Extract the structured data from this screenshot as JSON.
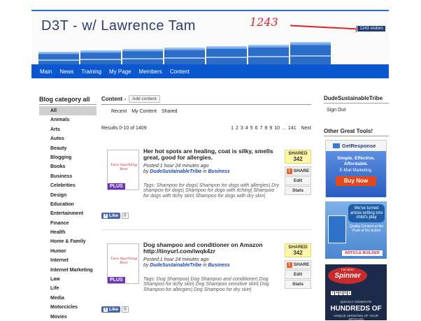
{
  "banner": {
    "title": "D3T - w/ Lawrence Tam",
    "handwritten_count": "1243",
    "visitors_label": "1243 visitors"
  },
  "nav": {
    "items": [
      "Main",
      "News",
      "Training",
      "My Page",
      "Members",
      "Content"
    ]
  },
  "left_sidebar": {
    "heading": "Blog category all",
    "categories": [
      "All",
      "Animals",
      "Arts",
      "Autos",
      "Beauty",
      "Blogging",
      "Books",
      "Business",
      "Celebrities",
      "Design",
      "Education",
      "Entertainment",
      "Finance",
      "Health",
      "Home & Family",
      "Humor",
      "Internet",
      "Internet Marketing",
      "Law",
      "Life",
      "Media",
      "Motorcicles",
      "Movies"
    ],
    "active": "All"
  },
  "main": {
    "title": "Content -",
    "add_button": "Add content",
    "subtabs": [
      "Recent",
      "My Content",
      "Shared"
    ],
    "results_text": "Results 0-10 of 1409",
    "pager": [
      "1",
      "2",
      "3",
      "4",
      "5",
      "6",
      "7",
      "8",
      "9",
      "10",
      "...",
      "141"
    ],
    "next_label": "Next",
    "posts": [
      {
        "thumb_text": "Twin Sparkling Best",
        "plus": "PLUS",
        "title": "Her hot spots are healing, coat is silky, smells great, good for allergies.",
        "posted": "Posted:1 hour 24 minutes ago",
        "by": "by",
        "author": "DudeSustainableTribe",
        "in": "in",
        "category": "Business",
        "tags": "Tags: Shampoo for dogs| Shampoo for dogs with allergies| Dry shampoo for dogs| Shampoo for dogs with itching| Shampoo for dogs with Itchy skin| Shampoo for dogs with dry skin|",
        "shared_label": "SHARED",
        "shared_count": "342",
        "share_btn": "SHARE",
        "edit_btn": "Edit",
        "stats_btn": "Stats",
        "like_label": "Like",
        "like_count": "0"
      },
      {
        "thumb_text": "Twin Sparkling Best",
        "plus": "PLUS",
        "title": "Dog shampoo and conditioner on Amazon http://tinyurl.com/iwqk4zr",
        "posted": "Posted:1 hour 24 minutes ago",
        "by": "by",
        "author": "DudeSustainableTribe",
        "in": "in",
        "category": "Business",
        "tags": "Tags: Dog Shampoo| Dog Shampoo and conditioner| Dog Shampoo for itchy skin| Dog Shampoo sensitive skin| Dog Shampoo for allergies| Dog Shampoo for dry skin|",
        "shared_label": "SHARED",
        "shared_count": "342",
        "share_btn": "SHARE",
        "edit_btn": "Edit",
        "stats_btn": "Stats",
        "like_label": "Like",
        "like_count": "0"
      }
    ]
  },
  "right_sidebar": {
    "heading": "DudeSustainableTribe",
    "signout": "Sign Out",
    "tools_heading": "Other Great Tools!",
    "getresponse": {
      "brand": "GetResponse",
      "line1": "Simple. Effective.",
      "line2": "Affordable.",
      "line3": "E-Mail Marketing.",
      "cta": "Buy Now"
    },
    "article_builder": {
      "bubble": "We've turned article writing into child's play",
      "sub": "Quality Content at the Push of the button",
      "logo": "ARTICLE BUILDER"
    },
    "spinner": {
      "badge_top": "THE BEST",
      "badge_big": "Spinner",
      "counter": [
        "7",
        "4",
        "6",
        "8",
        "1"
      ],
      "small1": "QUICKLY GENERATE",
      "big": "HUNDREDS OF",
      "small2": "UNIQUE VERSIONS OF YOUR ARTICLES"
    }
  }
}
